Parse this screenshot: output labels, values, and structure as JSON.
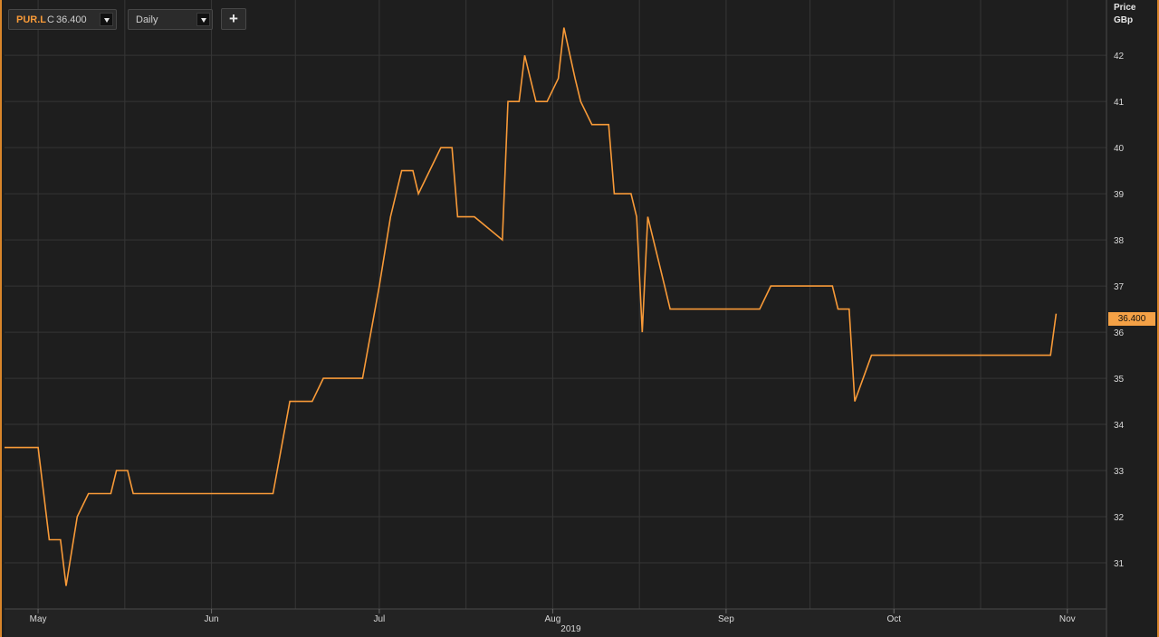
{
  "toolbar": {
    "ric": "PUR.L",
    "close_prefix": "C",
    "close_value": "36.400",
    "interval": "Daily",
    "add_label": "+"
  },
  "y_axis": {
    "title_line1": "Price",
    "title_line2": "GBp"
  },
  "last_price_label": "36.400",
  "year_label": "2019",
  "colors": {
    "line": "#f89a38",
    "background": "#1e1e1e",
    "grid": "#363636",
    "frame": "#d9852a"
  },
  "chart_data": {
    "type": "line",
    "xlabel": "",
    "ylabel": "Price GBp",
    "x_ticks": [
      "May",
      "Jun",
      "Jul",
      "Aug",
      "Sep",
      "Oct",
      "Nov"
    ],
    "x_tick_days": [
      1,
      32,
      62,
      93,
      124,
      154,
      185
    ],
    "x_range_days": [
      -5,
      192
    ],
    "x_days": [
      -5,
      1,
      3,
      5,
      6,
      8,
      10,
      14,
      15,
      17,
      18,
      19,
      43,
      46,
      50,
      52,
      59,
      62,
      64,
      66,
      68,
      69,
      71,
      73,
      75,
      76,
      78,
      79,
      84,
      85,
      87,
      88,
      90,
      92,
      94,
      95,
      97,
      98,
      100,
      103,
      104,
      107,
      108,
      109,
      110,
      112,
      113,
      114,
      130,
      132,
      143,
      144,
      146,
      147,
      150,
      152,
      155,
      182,
      183
    ],
    "values": [
      33.5,
      33.5,
      31.5,
      31.5,
      30.5,
      32.0,
      32.5,
      32.5,
      33.0,
      33.0,
      32.5,
      32.5,
      32.5,
      34.5,
      34.5,
      35.0,
      35.0,
      37.0,
      38.5,
      39.5,
      39.5,
      39.0,
      39.5,
      40.0,
      40.0,
      38.5,
      38.5,
      38.5,
      38.0,
      41.0,
      41.0,
      42.0,
      41.0,
      41.0,
      41.5,
      42.6,
      41.5,
      41.0,
      40.5,
      40.5,
      39.0,
      39.0,
      38.5,
      36.0,
      38.5,
      37.5,
      37.0,
      36.5,
      36.5,
      37.0,
      37.0,
      36.5,
      36.5,
      34.5,
      35.5,
      35.5,
      35.5,
      35.5,
      36.4
    ],
    "y_ticks": [
      31,
      32,
      33,
      34,
      35,
      36,
      37,
      38,
      39,
      40,
      41,
      42
    ],
    "ylim": [
      30.0,
      43.2
    ],
    "grid": true,
    "legend": "none"
  }
}
